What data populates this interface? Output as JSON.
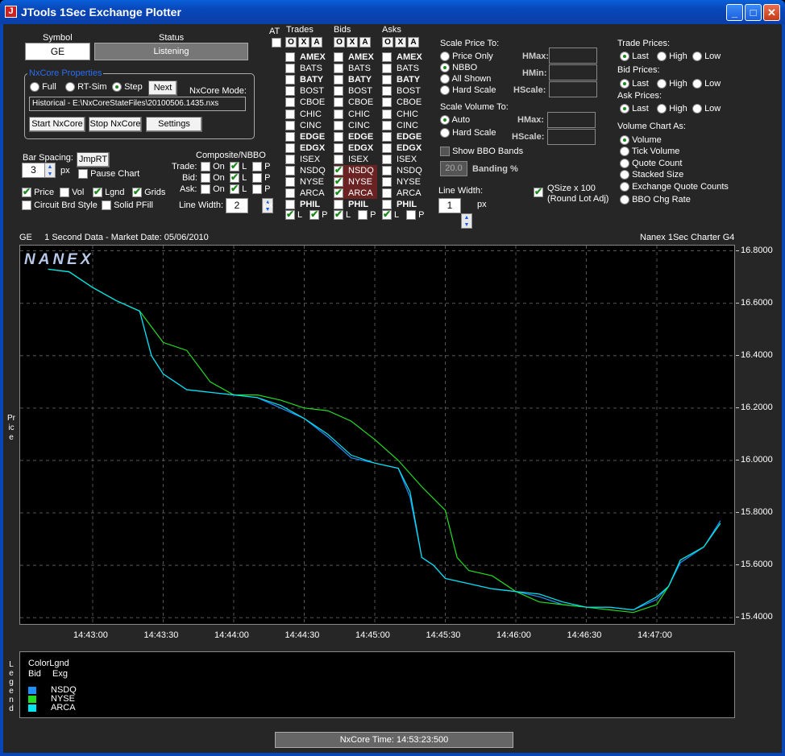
{
  "window": {
    "title": "JTools 1Sec Exchange Plotter"
  },
  "symbol": {
    "label": "Symbol",
    "value": "GE"
  },
  "status": {
    "label": "Status",
    "value": "Listening"
  },
  "nxcore": {
    "group_title": "NxCore Properties",
    "modes": [
      "Full",
      "RT-Sim",
      "Step"
    ],
    "selected_mode": "Step",
    "next_label": "Next",
    "mode_label": "NxCore Mode:",
    "mode_value": "Historical - E:\\NxCoreStateFiles\\20100506.1435.nxs",
    "start_label": "Start NxCore",
    "stop_label": "Stop NxCore",
    "settings_label": "Settings"
  },
  "bar_spacing": {
    "label": "Bar Spacing:",
    "value": "3",
    "unit": "px",
    "jmprt_label": "JmpRT",
    "pause_label": "Pause Chart"
  },
  "display_checks": [
    {
      "label": "Price",
      "checked": true
    },
    {
      "label": "Vol",
      "checked": false
    },
    {
      "label": "Lgnd",
      "checked": true
    },
    {
      "label": "Grids",
      "checked": true
    },
    {
      "label": "Circuit Brd Style",
      "checked": false
    },
    {
      "label": "Solid PFill",
      "checked": false
    }
  ],
  "composite": {
    "title": "Composite/NBBO",
    "rows": [
      "Trade:",
      "Bid:",
      "Ask:"
    ],
    "cols": [
      "On",
      "L",
      "P"
    ],
    "line_width_label": "Line Width:",
    "line_width_value": "2",
    "unit": "px"
  },
  "exchanges": {
    "at_label": "AT",
    "columns": [
      "Trades",
      "Bids",
      "Asks"
    ],
    "oxa": [
      "O",
      "X",
      "A"
    ],
    "list": [
      "AMEX",
      "BATS",
      "BATY",
      "BOST",
      "CBOE",
      "CHIC",
      "CINC",
      "EDGE",
      "EDGX",
      "ISEX",
      "NSDQ",
      "NYSE",
      "ARCA",
      "PHIL"
    ],
    "bid_selected": [
      "NSDQ",
      "NYSE",
      "ARCA"
    ],
    "lp": [
      "L",
      "P"
    ]
  },
  "scale_price": {
    "title": "Scale Price To:",
    "options": [
      "Price Only",
      "NBBO",
      "All Shown",
      "Hard Scale"
    ],
    "selected": "NBBO",
    "fields": [
      "HMax:",
      "HMin:",
      "HScale:"
    ]
  },
  "scale_volume": {
    "title": "Scale Volume To:",
    "options": [
      "Auto",
      "Hard Scale"
    ],
    "selected": "Auto",
    "fields": [
      "HMax:",
      "HScale:"
    ]
  },
  "bbo": {
    "show_label": "Show BBO Bands",
    "banding_value": "20.0",
    "banding_label": "Banding %"
  },
  "line_width2": {
    "label": "Line Width:",
    "value": "1",
    "unit": "px",
    "qsize_label": "QSize x 100",
    "qsize_sub": "(Round Lot Adj)"
  },
  "trade_prices": {
    "title": "Trade Prices:",
    "options": [
      "Last",
      "High",
      "Low"
    ],
    "selected": "Last"
  },
  "bid_prices": {
    "title": "Bid Prices:",
    "options": [
      "Last",
      "High",
      "Low"
    ],
    "selected": "Last"
  },
  "ask_prices": {
    "title": "Ask Prices:",
    "options": [
      "Last",
      "High",
      "Low"
    ],
    "selected": "Last"
  },
  "volume_chart": {
    "title": "Volume Chart As:",
    "options": [
      "Volume",
      "Tick Volume",
      "Quote Count",
      "Stacked Size",
      "Exchange Quote Counts",
      "BBO Chg Rate"
    ],
    "selected": "Volume"
  },
  "chart_header": {
    "left": "GE     1 Second Data - Market Date: 05/06/2010",
    "right": "Nanex 1Sec Charter G4",
    "watermark": "NANEX",
    "side_label": "Price"
  },
  "legend": {
    "side_label": "Legend",
    "title": "ColorLgnd",
    "col1": "Bid",
    "col2": "Exg",
    "items": [
      {
        "name": "NSDQ",
        "color": "#1e90ff"
      },
      {
        "name": "NYSE",
        "color": "#22dd22"
      },
      {
        "name": "ARCA",
        "color": "#00e5ee"
      }
    ]
  },
  "footer": {
    "time": "NxCore Time: 14:53:23:500"
  },
  "chart_data": {
    "type": "line",
    "x_ticks": [
      "14:43:00",
      "14:43:30",
      "14:44:00",
      "14:44:30",
      "14:45:00",
      "14:45:30",
      "14:46:00",
      "14:46:30",
      "14:47:00"
    ],
    "y_ticks": [
      "16.8000",
      "16.6000",
      "16.4000",
      "16.2000",
      "16.0000",
      "15.8000",
      "15.6000",
      "15.4000"
    ],
    "ylim": [
      15.37,
      16.82
    ],
    "grid": true,
    "series": [
      {
        "name": "NSDQ",
        "color": "#1e90ff",
        "x": [
          "14:42:41",
          "14:42:50",
          "14:43:00",
          "14:43:10",
          "14:43:20",
          "14:43:25",
          "14:43:30",
          "14:43:40",
          "14:43:50",
          "14:44:00",
          "14:44:10",
          "14:44:20",
          "14:44:30",
          "14:44:40",
          "14:44:50",
          "14:45:00",
          "14:45:10",
          "14:45:15",
          "14:45:20",
          "14:45:25",
          "14:45:30",
          "14:45:40",
          "14:45:50",
          "14:46:00",
          "14:46:10",
          "14:46:20",
          "14:46:30",
          "14:46:40",
          "14:46:50",
          "14:47:00",
          "14:47:05",
          "14:47:10",
          "14:47:20",
          "14:47:27"
        ],
        "values": [
          16.73,
          16.72,
          16.66,
          16.61,
          16.57,
          16.4,
          16.33,
          16.27,
          16.26,
          16.25,
          16.24,
          16.2,
          16.16,
          16.09,
          16.01,
          15.99,
          15.97,
          15.86,
          15.63,
          15.6,
          15.55,
          15.53,
          15.51,
          15.5,
          15.48,
          15.45,
          15.44,
          15.44,
          15.43,
          15.47,
          15.52,
          15.61,
          15.67,
          15.77
        ]
      },
      {
        "name": "NYSE",
        "color": "#22dd22",
        "x": [
          "14:42:41",
          "14:42:50",
          "14:43:00",
          "14:43:10",
          "14:43:20",
          "14:43:30",
          "14:43:40",
          "14:43:50",
          "14:44:00",
          "14:44:10",
          "14:44:20",
          "14:44:30",
          "14:44:40",
          "14:44:50",
          "14:45:00",
          "14:45:10",
          "14:45:20",
          "14:45:30",
          "14:45:35",
          "14:45:40",
          "14:45:50",
          "14:46:00",
          "14:46:10",
          "14:46:20",
          "14:46:30",
          "14:46:40",
          "14:46:50",
          "14:47:00",
          "14:47:05",
          "14:47:10",
          "14:47:20",
          "14:47:27"
        ],
        "values": [
          16.73,
          16.72,
          16.66,
          16.61,
          16.57,
          16.45,
          16.42,
          16.3,
          16.25,
          16.25,
          16.23,
          16.2,
          16.19,
          16.15,
          16.08,
          16.0,
          15.9,
          15.81,
          15.63,
          15.58,
          15.56,
          15.5,
          15.46,
          15.45,
          15.44,
          15.43,
          15.42,
          15.45,
          15.52,
          15.62,
          15.67,
          15.76
        ]
      },
      {
        "name": "ARCA",
        "color": "#00e5ee",
        "x": [
          "14:42:41",
          "14:42:50",
          "14:43:00",
          "14:43:10",
          "14:43:20",
          "14:43:25",
          "14:43:30",
          "14:43:40",
          "14:43:50",
          "14:44:00",
          "14:44:10",
          "14:44:20",
          "14:44:30",
          "14:44:40",
          "14:44:50",
          "14:45:00",
          "14:45:10",
          "14:45:15",
          "14:45:20",
          "14:45:25",
          "14:45:30",
          "14:45:40",
          "14:45:50",
          "14:46:00",
          "14:46:10",
          "14:46:20",
          "14:46:30",
          "14:46:40",
          "14:46:50",
          "14:47:00",
          "14:47:05",
          "14:47:10",
          "14:47:20",
          "14:47:27"
        ],
        "values": [
          16.73,
          16.72,
          16.66,
          16.61,
          16.57,
          16.4,
          16.33,
          16.27,
          16.26,
          16.25,
          16.24,
          16.21,
          16.16,
          16.1,
          16.02,
          15.99,
          15.97,
          15.88,
          15.63,
          15.6,
          15.55,
          15.53,
          15.51,
          15.5,
          15.49,
          15.46,
          15.44,
          15.44,
          15.43,
          15.48,
          15.52,
          15.62,
          15.67,
          15.76
        ]
      }
    ]
  }
}
